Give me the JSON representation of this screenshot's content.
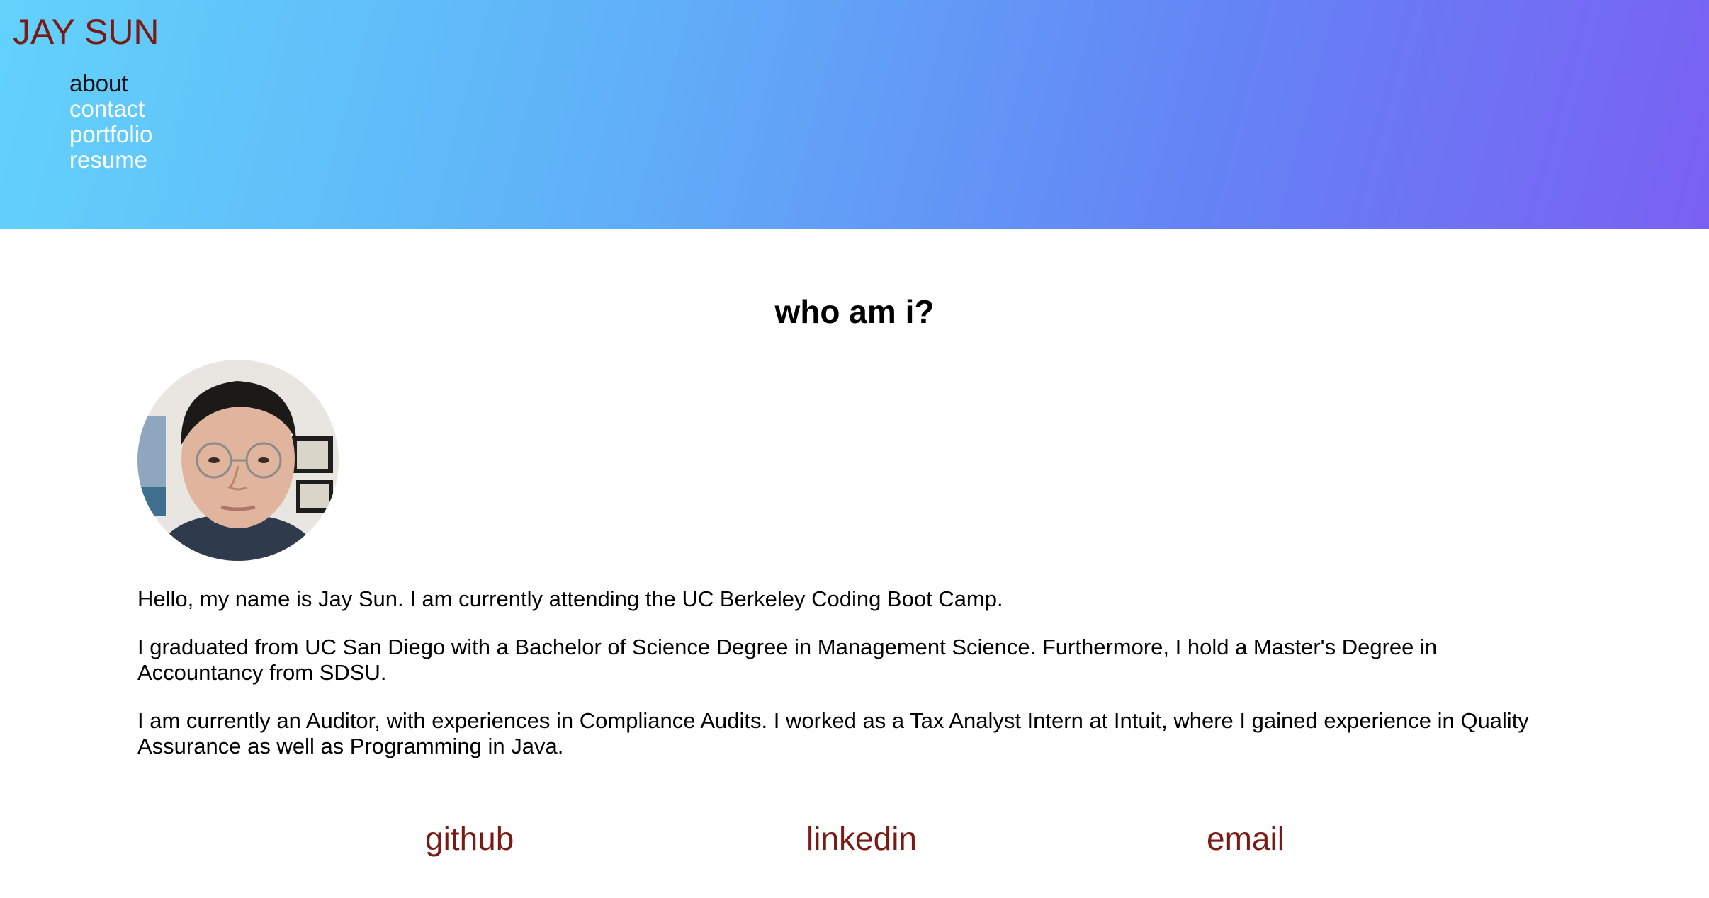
{
  "header": {
    "brand": "JAY SUN",
    "nav": [
      {
        "label": "about",
        "active": true
      },
      {
        "label": "contact",
        "active": false
      },
      {
        "label": "portfolio",
        "active": false
      },
      {
        "label": "resume",
        "active": false
      }
    ]
  },
  "colors": {
    "accent": "#7a1a14",
    "gradient_start": "#62d2fb",
    "gradient_end": "#7a60f4"
  },
  "main": {
    "title": "who am i?",
    "bio": [
      "Hello, my name is Jay Sun. I am currently attending the UC Berkeley Coding Boot Camp.",
      "I graduated from UC San Diego with a Bachelor of Science Degree in Management Science. Furthermore, I hold a Master's Degree in Accountancy from SDSU.",
      "I am currently an Auditor, with experiences in Compliance Audits. I worked as a Tax Analyst Intern at Intuit, where I gained experience in Quality Assurance as well as Programming in Java."
    ]
  },
  "links": {
    "github": "github",
    "linkedin": "linkedin",
    "email": "email"
  }
}
